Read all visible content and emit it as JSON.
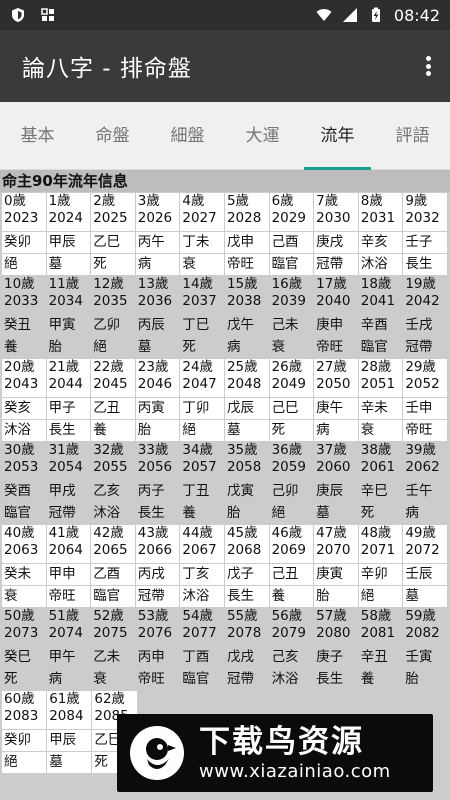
{
  "status_bar": {
    "time": "08:42",
    "icons": [
      "shield-icon",
      "grid-icon",
      "wifi-icon",
      "signal-icon",
      "battery-charging-icon"
    ]
  },
  "app_bar": {
    "title": "論八字 - 排命盤",
    "menu_icon": "more-vert-icon"
  },
  "tabs": [
    {
      "label": "基本",
      "active": false
    },
    {
      "label": "命盤",
      "active": false
    },
    {
      "label": "細盤",
      "active": false
    },
    {
      "label": "大運",
      "active": false
    },
    {
      "label": "流年",
      "active": true
    },
    {
      "label": "評語",
      "active": false
    }
  ],
  "colors": {
    "tab_indicator": "#1a9e8f",
    "app_bar": "#3a3a3a",
    "status_bar": "#2e2e2e",
    "table_bg": "#cccccc"
  },
  "section_title": "命主90年流年信息",
  "groups": [
    {
      "ages": [
        "0歲",
        "1歲",
        "2歲",
        "3歲",
        "4歲",
        "5歲",
        "6歲",
        "7歲",
        "8歲",
        "9歲"
      ],
      "years": [
        "2023",
        "2024",
        "2025",
        "2026",
        "2027",
        "2028",
        "2029",
        "2030",
        "2031",
        "2032"
      ],
      "ganzhi": [
        "癸卯",
        "甲辰",
        "乙巳",
        "丙午",
        "丁未",
        "戊申",
        "己酉",
        "庚戌",
        "辛亥",
        "壬子"
      ],
      "stage": [
        "絕",
        "墓",
        "死",
        "病",
        "衰",
        "帝旺",
        "臨官",
        "冠帶",
        "沐浴",
        "長生"
      ]
    },
    {
      "ages": [
        "10歲",
        "11歲",
        "12歲",
        "13歲",
        "14歲",
        "15歲",
        "16歲",
        "17歲",
        "18歲",
        "19歲"
      ],
      "years": [
        "2033",
        "2034",
        "2035",
        "2036",
        "2037",
        "2038",
        "2039",
        "2040",
        "2041",
        "2042"
      ],
      "ganzhi": [
        "癸丑",
        "甲寅",
        "乙卯",
        "丙辰",
        "丁巳",
        "戊午",
        "己未",
        "庚申",
        "辛酉",
        "壬戌"
      ],
      "stage": [
        "養",
        "胎",
        "絕",
        "墓",
        "死",
        "病",
        "衰",
        "帝旺",
        "臨官",
        "冠帶"
      ]
    },
    {
      "ages": [
        "20歲",
        "21歲",
        "22歲",
        "23歲",
        "24歲",
        "25歲",
        "26歲",
        "27歲",
        "28歲",
        "29歲"
      ],
      "years": [
        "2043",
        "2044",
        "2045",
        "2046",
        "2047",
        "2048",
        "2049",
        "2050",
        "2051",
        "2052"
      ],
      "ganzhi": [
        "癸亥",
        "甲子",
        "乙丑",
        "丙寅",
        "丁卯",
        "戊辰",
        "己巳",
        "庚午",
        "辛未",
        "壬申"
      ],
      "stage": [
        "沐浴",
        "長生",
        "養",
        "胎",
        "絕",
        "墓",
        "死",
        "病",
        "衰",
        "帝旺"
      ]
    },
    {
      "ages": [
        "30歲",
        "31歲",
        "32歲",
        "33歲",
        "34歲",
        "35歲",
        "36歲",
        "37歲",
        "38歲",
        "39歲"
      ],
      "years": [
        "2053",
        "2054",
        "2055",
        "2056",
        "2057",
        "2058",
        "2059",
        "2060",
        "2061",
        "2062"
      ],
      "ganzhi": [
        "癸酉",
        "甲戌",
        "乙亥",
        "丙子",
        "丁丑",
        "戊寅",
        "己卯",
        "庚辰",
        "辛巳",
        "壬午"
      ],
      "stage": [
        "臨官",
        "冠帶",
        "沐浴",
        "長生",
        "養",
        "胎",
        "絕",
        "墓",
        "死",
        "病"
      ]
    },
    {
      "ages": [
        "40歲",
        "41歲",
        "42歲",
        "43歲",
        "44歲",
        "45歲",
        "46歲",
        "47歲",
        "48歲",
        "49歲"
      ],
      "years": [
        "2063",
        "2064",
        "2065",
        "2066",
        "2067",
        "2068",
        "2069",
        "2070",
        "2071",
        "2072"
      ],
      "ganzhi": [
        "癸未",
        "甲申",
        "乙酉",
        "丙戌",
        "丁亥",
        "戊子",
        "己丑",
        "庚寅",
        "辛卯",
        "壬辰"
      ],
      "stage": [
        "衰",
        "帝旺",
        "臨官",
        "冠帶",
        "沐浴",
        "長生",
        "養",
        "胎",
        "絕",
        "墓"
      ]
    },
    {
      "ages": [
        "50歲",
        "51歲",
        "52歲",
        "53歲",
        "54歲",
        "55歲",
        "56歲",
        "57歲",
        "58歲",
        "59歲"
      ],
      "years": [
        "2073",
        "2074",
        "2075",
        "2076",
        "2077",
        "2078",
        "2079",
        "2080",
        "2081",
        "2082"
      ],
      "ganzhi": [
        "癸巳",
        "甲午",
        "乙未",
        "丙申",
        "丁酉",
        "戊戌",
        "己亥",
        "庚子",
        "辛丑",
        "壬寅"
      ],
      "stage": [
        "死",
        "病",
        "衰",
        "帝旺",
        "臨官",
        "冠帶",
        "沐浴",
        "長生",
        "養",
        "胎"
      ]
    },
    {
      "ages": [
        "60歲",
        "61歲",
        "62歲"
      ],
      "years": [
        "2083",
        "2084",
        "2085"
      ],
      "ganzhi": [
        "癸卯",
        "甲辰",
        "乙巳"
      ],
      "stage": [
        "絕",
        "墓",
        "死"
      ]
    }
  ],
  "watermark": {
    "logo_icon": "bird-logo-icon",
    "big_text": "下载鸟资源",
    "small_text": "www.xiazainiao.com"
  }
}
